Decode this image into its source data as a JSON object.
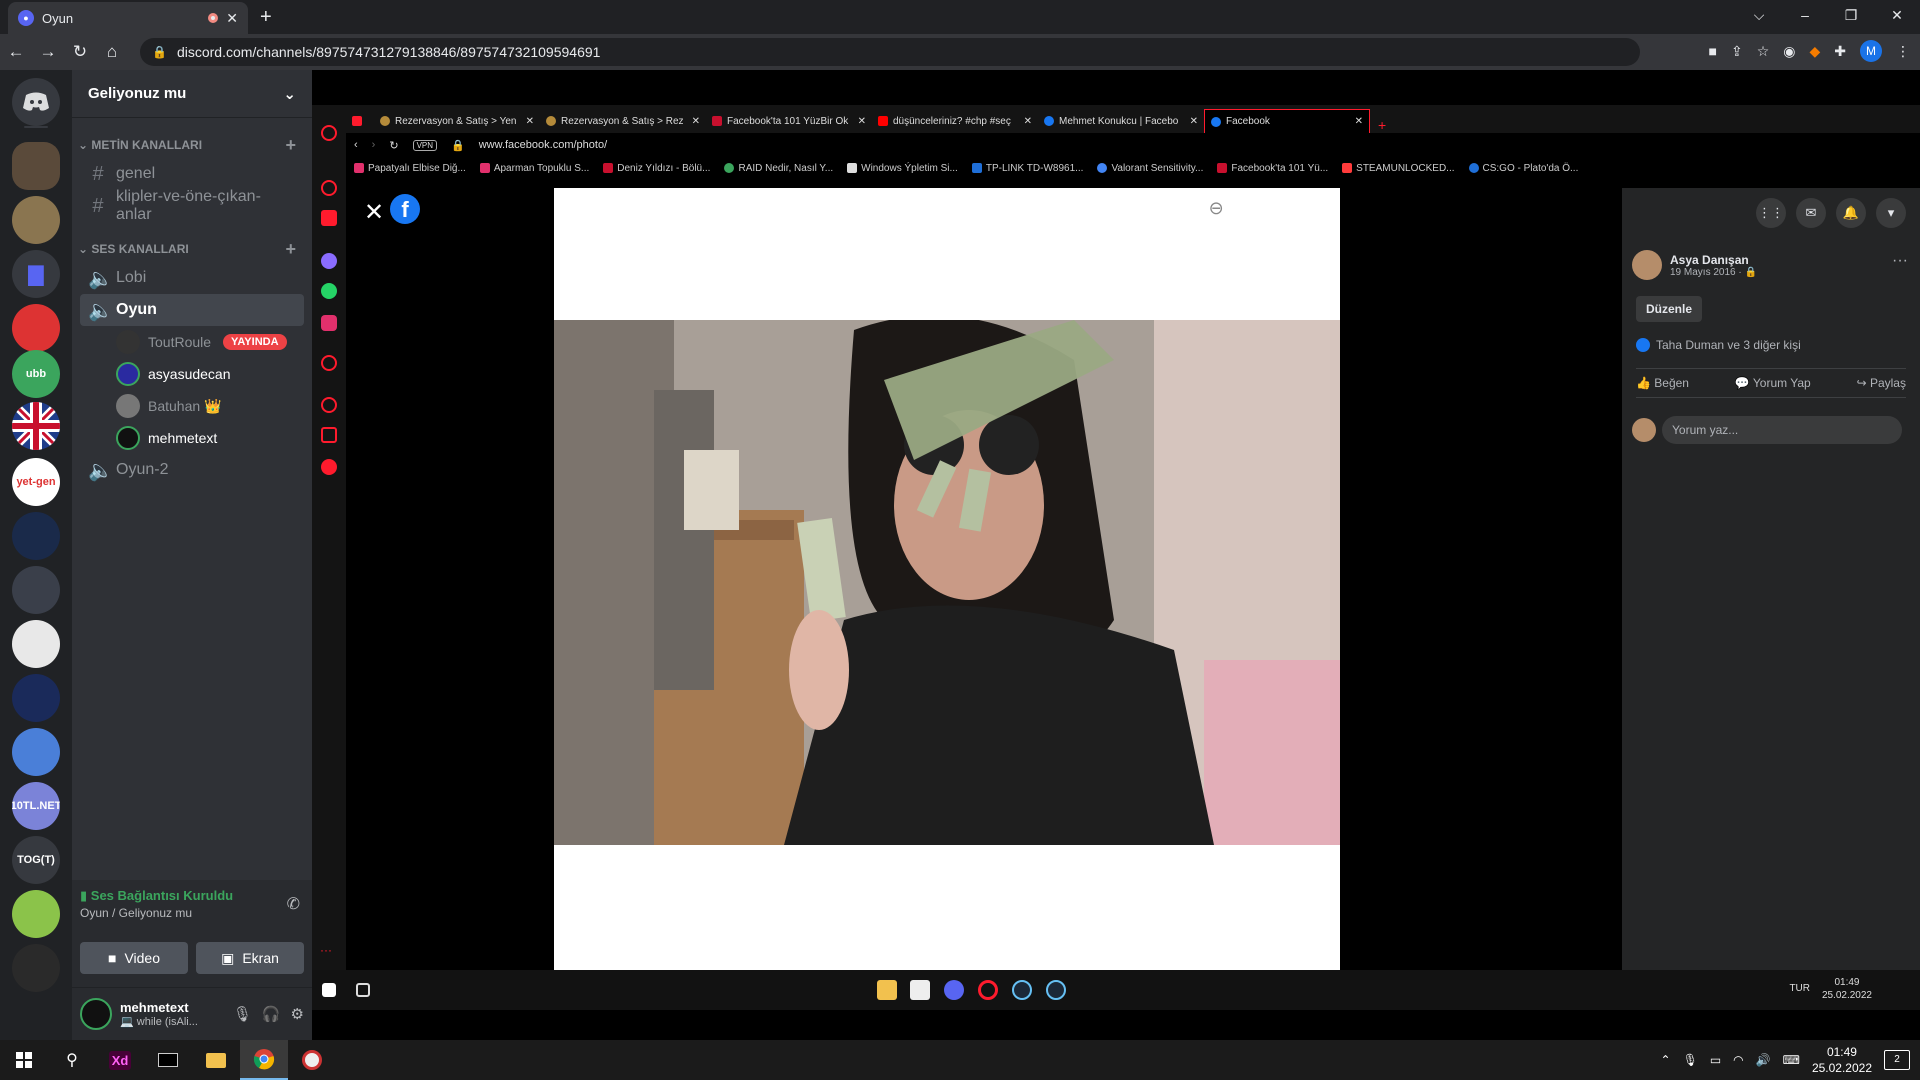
{
  "chrome": {
    "tab_title": "Oyun",
    "url": "discord.com/channels/897574731279138846/897574732109594691",
    "profile_initial": "M",
    "win_controls": [
      "⌵",
      "–",
      "❐",
      "✕"
    ]
  },
  "discord": {
    "server_name": "Geliyonuz mu",
    "categories": {
      "text": "METİN KANALLARI",
      "voice": "SES KANALLARI"
    },
    "text_channels": [
      "genel",
      "klipler-ve-öne-çıkan-anlar"
    ],
    "voice_channels": {
      "lobi": "Lobi",
      "oyun": "Oyun",
      "oyun2": "Oyun-2"
    },
    "voice_users": [
      {
        "name": "ToutRoule",
        "badge": "YAYINDA"
      },
      {
        "name": "asyasudecan"
      },
      {
        "name": "Batuhan 👑"
      },
      {
        "name": "mehmetext"
      }
    ],
    "guild_labels": {
      "yetgen": "yet-gen",
      "tog": "TOG(T)",
      "net": "10TL.NET",
      "dubb": "ubb"
    },
    "voice_panel": {
      "status": "Ses Bağlantısı Kuruldu",
      "channel": "Oyun / Geliyonuz mu",
      "video": "Video",
      "screen": "Ekran"
    },
    "user": {
      "name": "mehmetext",
      "status": "💻 while (isAli..."
    }
  },
  "opera": {
    "tabs": [
      "Rezervasyon & Satış > Yen",
      "Rezervasyon & Satış > Rez",
      "Facebook'ta 101 YüzBir Ok",
      "düşünceleriniz? #chp #seç",
      "Mehmet Konukcu | Facebo",
      "Facebook"
    ],
    "address": "www.facebook.com/photo/",
    "vpn": "VPN",
    "bookmarks": [
      "Papatyalı Elbise Diğ...",
      "Aparman Topuklu S...",
      "Deniz Yıldızı - Bölü...",
      "RAID Nedir, Nasıl Y...",
      "Windows Ýpletim Si...",
      "TP-LINK TD-W8961...",
      "Valorant Sensitivity...",
      "Facebook'ta 101 Yü...",
      "STEAMUNLOCKED...",
      "CS:GO - Plato'da Ö..."
    ]
  },
  "facebook": {
    "author": "Asya Danışan",
    "date": "19 Mayıs 2016 · 🔒",
    "edit": "Düzenle",
    "likes": "Taha Duman ve 3 diğer kişi",
    "actions": [
      "Beğen",
      "Yorum Yap",
      "Paylaş"
    ],
    "comment_placeholder": "Yorum yaz..."
  },
  "inner_taskbar": {
    "time": "01:49",
    "date": "25.02.2022",
    "lang": "TUR"
  },
  "taskbar": {
    "time": "01:49",
    "date": "25.02.2022",
    "notifications": "2",
    "xd_label": "Xd"
  },
  "colors": {
    "discord_blurple": "#5865f2",
    "live_red": "#ed4245",
    "online_green": "#3ba55d",
    "facebook_blue": "#1877f2",
    "opera_red": "#ff1b2d"
  }
}
